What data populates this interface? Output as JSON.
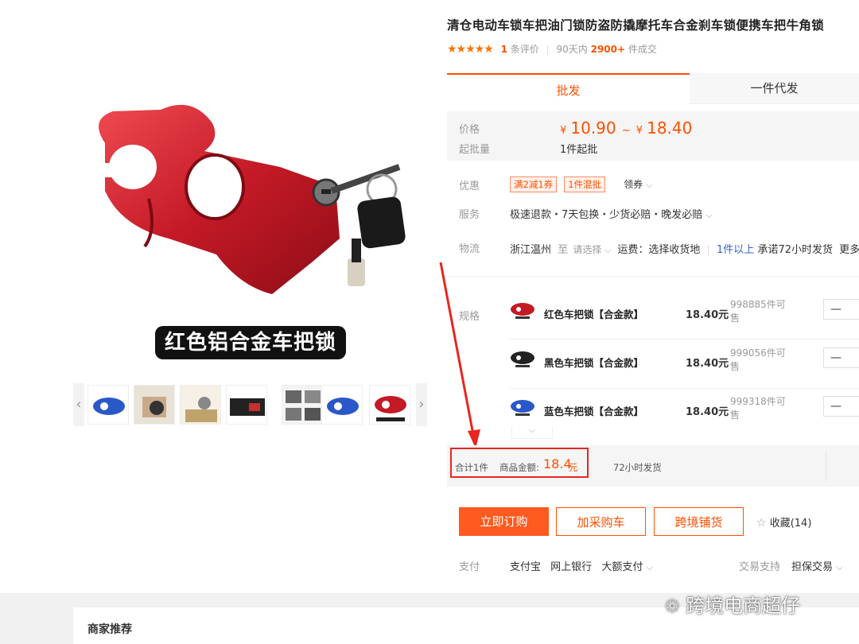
{
  "product": {
    "title": "清仓电动车锁车把油门锁防盗防撬摩托车合金刹车锁便携车把牛角锁",
    "image_caption": "红色铝合金车把锁"
  },
  "rating": {
    "stars": "★★★★★",
    "review_count": "1",
    "review_label": "条评价",
    "days_label": "90天内",
    "sold_count": "2900+",
    "sold_label": "件成交"
  },
  "tabs": {
    "wholesale": "批发",
    "dropship": "一件代发"
  },
  "price": {
    "label": "价格",
    "currency": "¥",
    "min": "10.90",
    "tilde": "~",
    "max": "18.40",
    "moq_label": "起批量",
    "moq_value": "1件起批"
  },
  "promo": {
    "label": "优惠",
    "tag1": "满2减1券",
    "tag2": "1件混批",
    "coupon_link": "领券"
  },
  "service": {
    "label": "服务",
    "text": "极速退款・7天包换・少货必赔・晚发必赔"
  },
  "logistics": {
    "label": "物流",
    "origin": "浙江温州",
    "to": "至",
    "select": "请选择",
    "fee": "运费：选择收货地",
    "qty_rule": "1件以上",
    "promise": "承诺72小时发货",
    "more": "更多"
  },
  "sku": {
    "label": "规格",
    "rows": [
      {
        "name": "红色车把锁【合金款】",
        "price": "18.40元",
        "stock": "998885件可售",
        "minus": "—"
      },
      {
        "name": "黑色车把锁【合金款】",
        "price": "18.40元",
        "stock": "999056件可售",
        "minus": "—"
      },
      {
        "name": "蓝色车把锁【合金款】",
        "price": "18.40元",
        "stock": "999318件可售",
        "minus": "—"
      }
    ]
  },
  "summary": {
    "total_label": "合计1件",
    "amount_label": "商品金额:",
    "amount": "18.4",
    "unit": "元",
    "ship": "72小时发货"
  },
  "actions": {
    "order": "立即订购",
    "cart": "加采购车",
    "cross": "跨境铺货",
    "favorite": "收藏(14)"
  },
  "payment": {
    "label": "支付",
    "alipay": "支付宝",
    "bank": "网上银行",
    "large": "大额支付",
    "trade_support": "交易支持",
    "escrow": "担保交易"
  },
  "footer": {
    "merchant_recommend": "商家推荐",
    "watermark": "跨境电商超仔"
  },
  "colors": {
    "accent": "#ff5000",
    "annotation": "#e8261f"
  }
}
